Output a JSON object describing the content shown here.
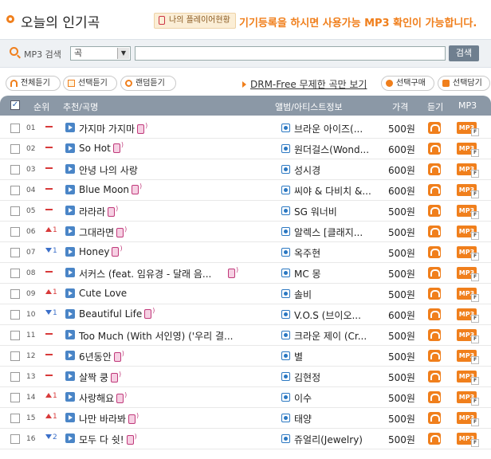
{
  "header": {
    "title": "오늘의 인기곡",
    "player_tag": "나의 플레이어현황",
    "notice": "기기등록을 하시면 사용가능 MP3 확인이 가능합니다."
  },
  "search": {
    "label": "MP3 검색",
    "select_value": "곡",
    "input_value": "",
    "button_label": "검색"
  },
  "toolbar": {
    "listen_all": "전체듣기",
    "listen_selected": "선택듣기",
    "listen_random": "랜덤듣기",
    "drm_link": "DRM-Free 무제한 곡만 보기",
    "buy_selected": "선택구매",
    "add_selected": "선택담기"
  },
  "table": {
    "headers": {
      "rank": "순위",
      "song": "추천/곡명",
      "album": "앨범/아티스트정보",
      "price": "가격",
      "listen": "듣기",
      "mp3": "MP3"
    },
    "mp3_badge": "MP3",
    "rows": [
      {
        "rank": "01",
        "change": "—",
        "dir": "none",
        "title": "가지마 가지마",
        "artist": "브라운 아이즈(...",
        "price": "500원",
        "phone_sep": false
      },
      {
        "rank": "02",
        "change": "—",
        "dir": "none",
        "title": "So Hot",
        "artist": "원더걸스(Wond...",
        "price": "600원",
        "phone_sep": false
      },
      {
        "rank": "03",
        "change": "—",
        "dir": "none",
        "title": "안녕 나의 사랑",
        "artist": "성시경",
        "price": "600원",
        "phone_sep": false,
        "no_phone": true
      },
      {
        "rank": "04",
        "change": "—",
        "dir": "none",
        "title": "Blue Moon",
        "artist": "씨야 & 다비치 &...",
        "price": "600원",
        "phone_sep": false
      },
      {
        "rank": "05",
        "change": "—",
        "dir": "none",
        "title": "라라라",
        "artist": "SG 워너비",
        "price": "500원",
        "phone_sep": false
      },
      {
        "rank": "06",
        "change": "1",
        "dir": "up",
        "title": "그대라면",
        "artist": "알렉스 [클래지...",
        "price": "500원",
        "phone_sep": false
      },
      {
        "rank": "07",
        "change": "1",
        "dir": "down",
        "title": "Honey",
        "artist": "옥주현",
        "price": "500원",
        "phone_sep": false
      },
      {
        "rank": "08",
        "change": "—",
        "dir": "none",
        "title": "서커스 (feat. 임유경 - 달래 음...",
        "artist": "MC 몽",
        "price": "500원",
        "phone_sep": true
      },
      {
        "rank": "09",
        "change": "1",
        "dir": "up",
        "title": "Cute Love",
        "artist": "솔비",
        "price": "500원",
        "phone_sep": false,
        "no_phone": true
      },
      {
        "rank": "10",
        "change": "1",
        "dir": "down",
        "title": "Beautiful Life",
        "artist": "V.O.S (브이오...",
        "price": "600원",
        "phone_sep": false
      },
      {
        "rank": "11",
        "change": "—",
        "dir": "none",
        "title": "Too Much (With 서인영) ('우리 결...",
        "artist": "크라운 제이 (Cr...",
        "price": "500원",
        "phone_sep": false,
        "no_phone": true
      },
      {
        "rank": "12",
        "change": "—",
        "dir": "none",
        "title": "6년동안",
        "artist": "별",
        "price": "500원",
        "phone_sep": false
      },
      {
        "rank": "13",
        "change": "—",
        "dir": "none",
        "title": "살짝 쿵",
        "artist": "김현정",
        "price": "500원",
        "phone_sep": false
      },
      {
        "rank": "14",
        "change": "1",
        "dir": "up",
        "title": "사랑해요",
        "artist": "이수",
        "price": "500원",
        "phone_sep": false
      },
      {
        "rank": "15",
        "change": "1",
        "dir": "up",
        "title": "나만 바라봐",
        "artist": "태양",
        "price": "500원",
        "phone_sep": false
      },
      {
        "rank": "16",
        "change": "2",
        "dir": "down",
        "title": "모두 다 쉿!",
        "artist": "쥬얼리(Jewelry)",
        "price": "500원",
        "phone_sep": false
      }
    ]
  },
  "colors": {
    "accent": "#f07f1c",
    "header_bg": "#8b98a6",
    "up": "#d83a3a",
    "down": "#3b6fc9"
  }
}
